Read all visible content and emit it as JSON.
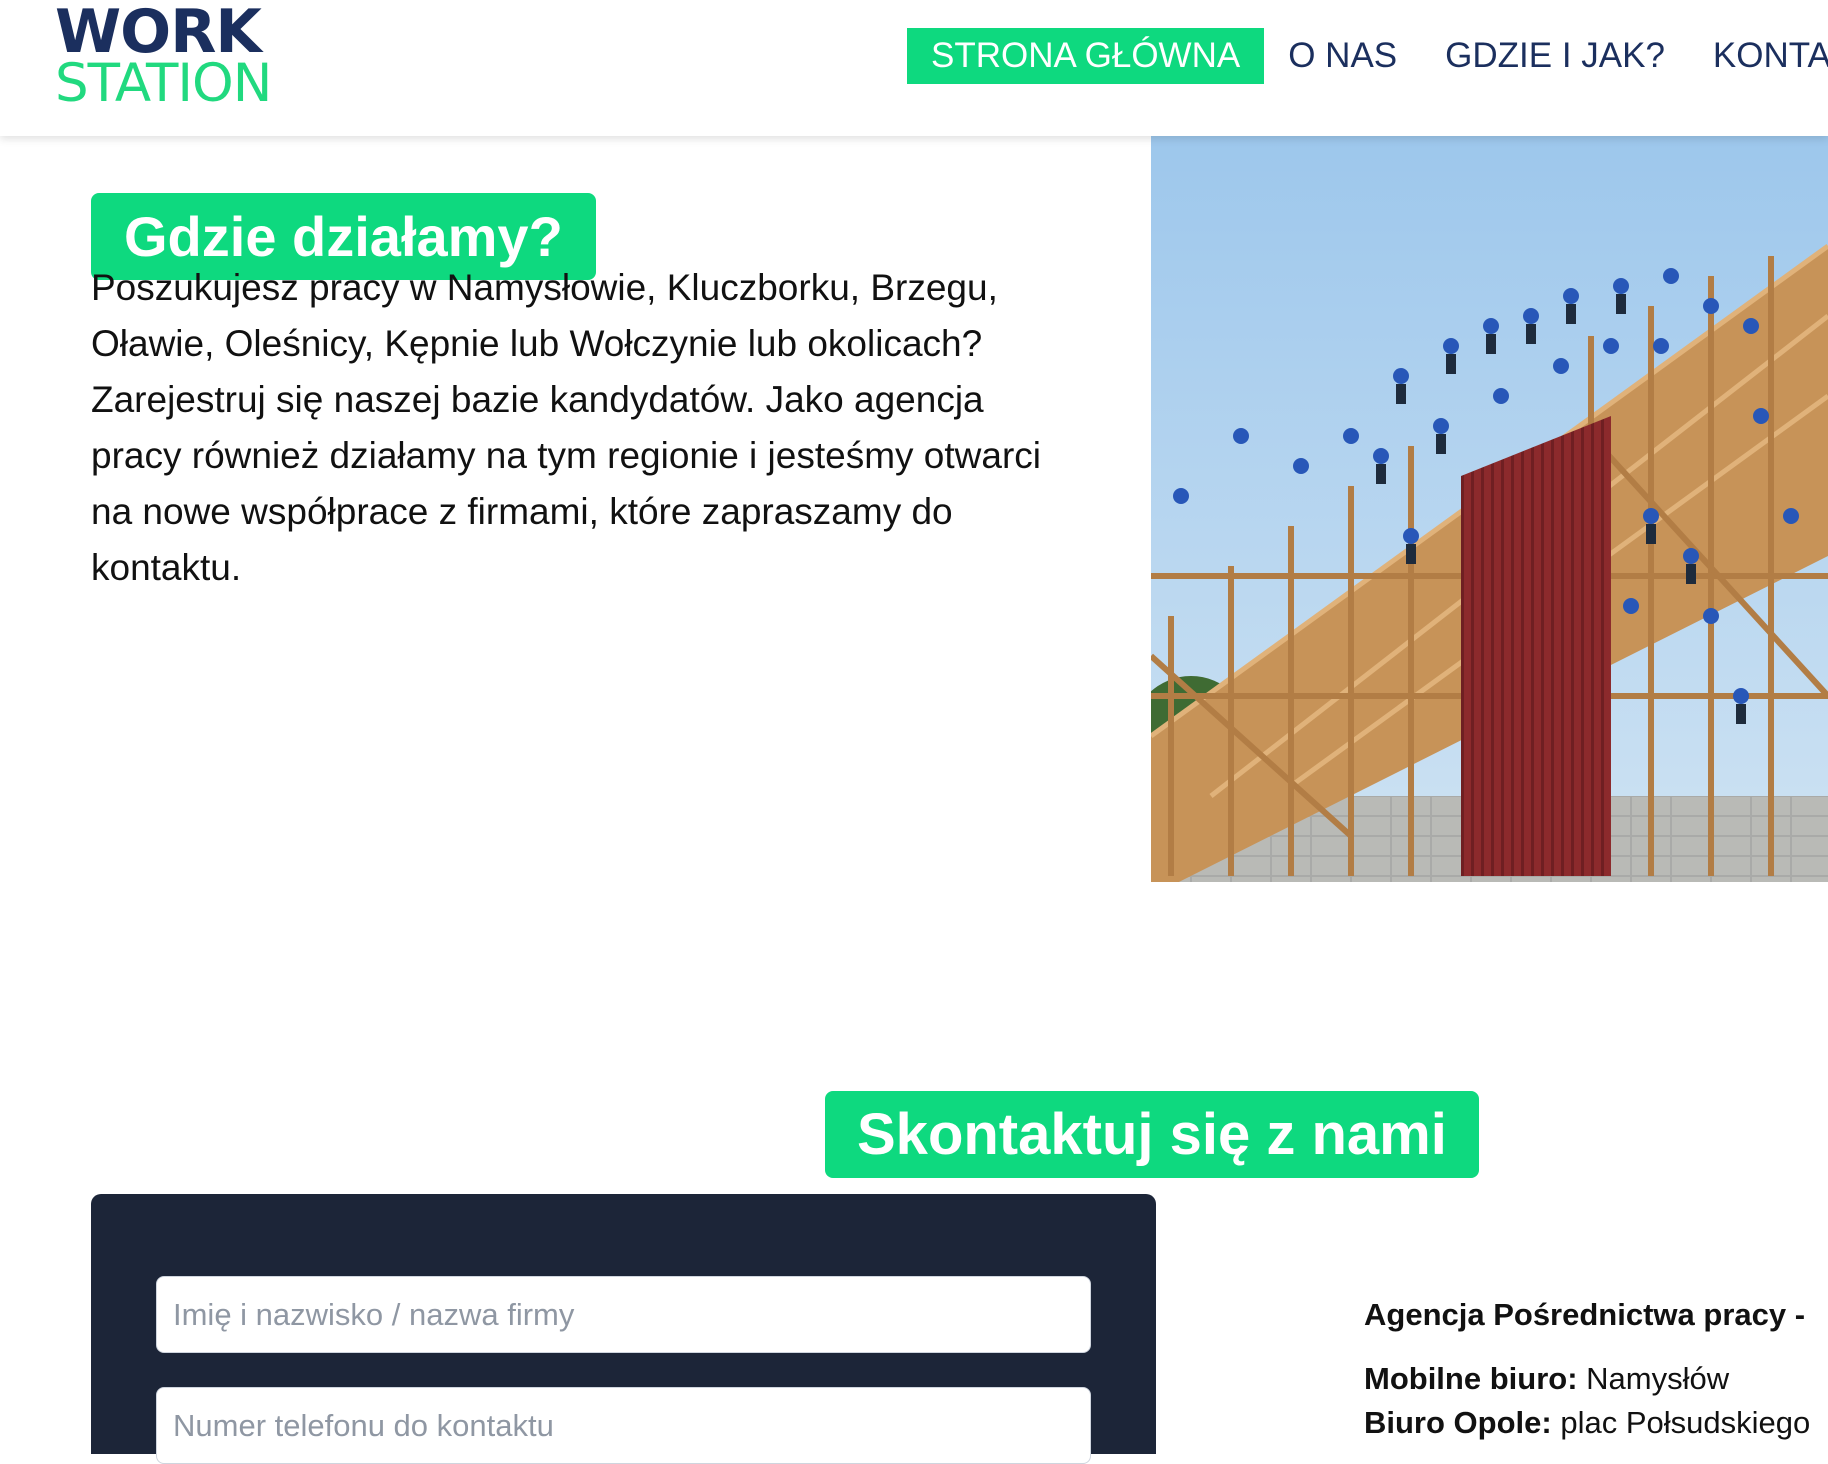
{
  "header": {
    "logo_line1": "WORK",
    "logo_line2": "STATION",
    "nav": [
      {
        "label": "STRONA GŁÓWNA",
        "active": true
      },
      {
        "label": "O NAS",
        "active": false
      },
      {
        "label": "GDZIE I JAK?",
        "active": false
      },
      {
        "label": "KONTA",
        "active": false
      }
    ]
  },
  "where": {
    "title": "Gdzie działamy?",
    "text": "Poszukujesz pracy w Namysłowie, Kluczborku, Brzegu, Oławie, Oleśnicy, Kępnie lub Wołczynie lub okolicach? Zarejestruj się naszej bazie kandydatów. Jako agencja pracy również działamy na tym regionie i jesteśmy otwarci na nowe współprace z firmami, które zapraszamy do kontaktu."
  },
  "contact": {
    "title": "Skontaktuj się z nami",
    "form": {
      "name_placeholder": "Imię i nazwisko / nazwa firmy",
      "phone_placeholder": "Numer telefonu do kontaktu"
    },
    "info": {
      "heading": "Agencja Pośrednictwa pracy -",
      "mobile_label": "Mobilne biuro:",
      "mobile_value": " Namysłów",
      "opole_label": "Biuro Opole:",
      "opole_value": " plac Połsudskiego"
    }
  },
  "colors": {
    "accent": "#0ed97f",
    "navy": "#1b2f5e",
    "panel": "#1c2538"
  }
}
